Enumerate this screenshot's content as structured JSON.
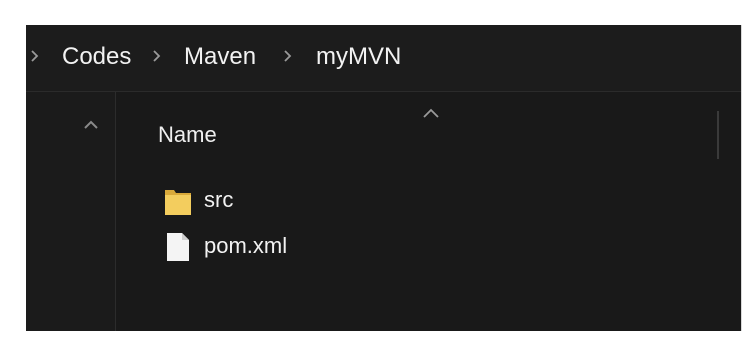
{
  "breadcrumb": {
    "items": [
      {
        "label": "Codes"
      },
      {
        "label": "Maven"
      },
      {
        "label": "myMVN"
      }
    ]
  },
  "file_list": {
    "column_header": "Name",
    "items": [
      {
        "name": "src",
        "icon": "folder-icon"
      },
      {
        "name": "pom.xml",
        "icon": "file-icon"
      }
    ]
  },
  "colors": {
    "background": "#191919",
    "text": "#f2f2f2",
    "folder": "#f3cd5e"
  }
}
